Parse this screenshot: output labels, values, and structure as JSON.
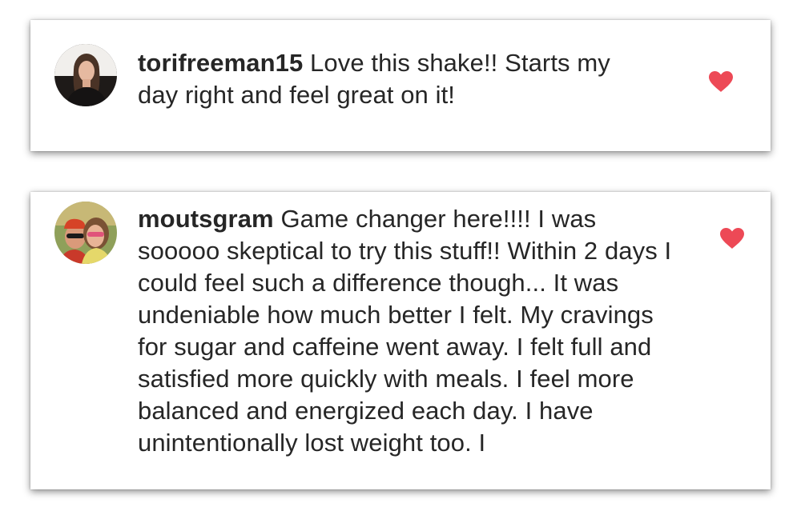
{
  "comments": [
    {
      "username": "torifreeman15",
      "text": "Love this shake!! Starts my day right and feel great on it!",
      "liked": true
    },
    {
      "username": "moutsgram",
      "text": "Game changer here!!!! I was sooooo skeptical to try this stuff!! Within 2 days I could feel such a difference though... It was undeniable how much better I felt. My cravings for sugar and caffeine went away. I felt full and satisfied more quickly with meals. I feel more balanced and energized each day. I have unintentionally lost weight too. I",
      "liked": true
    }
  ],
  "colors": {
    "heart": "#ed4956",
    "text": "#262626"
  },
  "icons": {
    "like": "heart-icon",
    "avatar": "user-avatar"
  }
}
